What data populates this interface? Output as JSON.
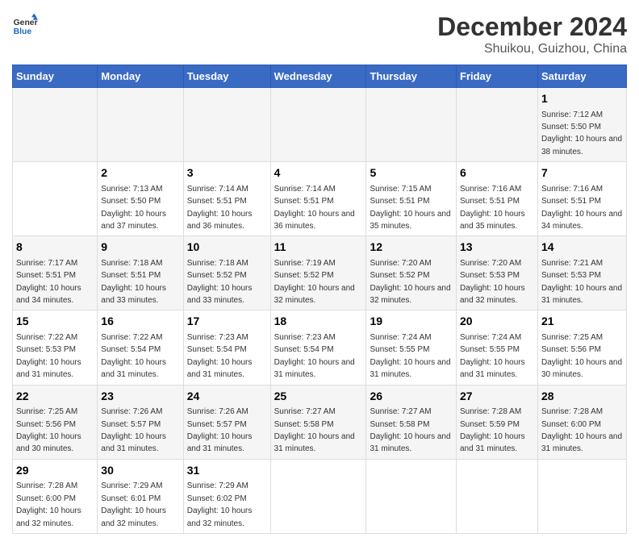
{
  "header": {
    "logo_line1": "General",
    "logo_line2": "Blue",
    "title": "December 2024",
    "subtitle": "Shuikou, Guizhou, China"
  },
  "calendar": {
    "days_of_week": [
      "Sunday",
      "Monday",
      "Tuesday",
      "Wednesday",
      "Thursday",
      "Friday",
      "Saturday"
    ],
    "weeks": [
      [
        null,
        null,
        null,
        null,
        null,
        null,
        {
          "day": "1",
          "sunrise": "Sunrise: 7:12 AM",
          "sunset": "Sunset: 5:50 PM",
          "daylight": "Daylight: 10 hours and 38 minutes."
        }
      ],
      [
        null,
        {
          "day": "2",
          "sunrise": "Sunrise: 7:13 AM",
          "sunset": "Sunset: 5:50 PM",
          "daylight": "Daylight: 10 hours and 37 minutes."
        },
        {
          "day": "3",
          "sunrise": "Sunrise: 7:14 AM",
          "sunset": "Sunset: 5:51 PM",
          "daylight": "Daylight: 10 hours and 36 minutes."
        },
        {
          "day": "4",
          "sunrise": "Sunrise: 7:14 AM",
          "sunset": "Sunset: 5:51 PM",
          "daylight": "Daylight: 10 hours and 36 minutes."
        },
        {
          "day": "5",
          "sunrise": "Sunrise: 7:15 AM",
          "sunset": "Sunset: 5:51 PM",
          "daylight": "Daylight: 10 hours and 35 minutes."
        },
        {
          "day": "6",
          "sunrise": "Sunrise: 7:16 AM",
          "sunset": "Sunset: 5:51 PM",
          "daylight": "Daylight: 10 hours and 35 minutes."
        },
        {
          "day": "7",
          "sunrise": "Sunrise: 7:16 AM",
          "sunset": "Sunset: 5:51 PM",
          "daylight": "Daylight: 10 hours and 34 minutes."
        }
      ],
      [
        {
          "day": "8",
          "sunrise": "Sunrise: 7:17 AM",
          "sunset": "Sunset: 5:51 PM",
          "daylight": "Daylight: 10 hours and 34 minutes."
        },
        {
          "day": "9",
          "sunrise": "Sunrise: 7:18 AM",
          "sunset": "Sunset: 5:51 PM",
          "daylight": "Daylight: 10 hours and 33 minutes."
        },
        {
          "day": "10",
          "sunrise": "Sunrise: 7:18 AM",
          "sunset": "Sunset: 5:52 PM",
          "daylight": "Daylight: 10 hours and 33 minutes."
        },
        {
          "day": "11",
          "sunrise": "Sunrise: 7:19 AM",
          "sunset": "Sunset: 5:52 PM",
          "daylight": "Daylight: 10 hours and 32 minutes."
        },
        {
          "day": "12",
          "sunrise": "Sunrise: 7:20 AM",
          "sunset": "Sunset: 5:52 PM",
          "daylight": "Daylight: 10 hours and 32 minutes."
        },
        {
          "day": "13",
          "sunrise": "Sunrise: 7:20 AM",
          "sunset": "Sunset: 5:53 PM",
          "daylight": "Daylight: 10 hours and 32 minutes."
        },
        {
          "day": "14",
          "sunrise": "Sunrise: 7:21 AM",
          "sunset": "Sunset: 5:53 PM",
          "daylight": "Daylight: 10 hours and 31 minutes."
        }
      ],
      [
        {
          "day": "15",
          "sunrise": "Sunrise: 7:22 AM",
          "sunset": "Sunset: 5:53 PM",
          "daylight": "Daylight: 10 hours and 31 minutes."
        },
        {
          "day": "16",
          "sunrise": "Sunrise: 7:22 AM",
          "sunset": "Sunset: 5:54 PM",
          "daylight": "Daylight: 10 hours and 31 minutes."
        },
        {
          "day": "17",
          "sunrise": "Sunrise: 7:23 AM",
          "sunset": "Sunset: 5:54 PM",
          "daylight": "Daylight: 10 hours and 31 minutes."
        },
        {
          "day": "18",
          "sunrise": "Sunrise: 7:23 AM",
          "sunset": "Sunset: 5:54 PM",
          "daylight": "Daylight: 10 hours and 31 minutes."
        },
        {
          "day": "19",
          "sunrise": "Sunrise: 7:24 AM",
          "sunset": "Sunset: 5:55 PM",
          "daylight": "Daylight: 10 hours and 31 minutes."
        },
        {
          "day": "20",
          "sunrise": "Sunrise: 7:24 AM",
          "sunset": "Sunset: 5:55 PM",
          "daylight": "Daylight: 10 hours and 31 minutes."
        },
        {
          "day": "21",
          "sunrise": "Sunrise: 7:25 AM",
          "sunset": "Sunset: 5:56 PM",
          "daylight": "Daylight: 10 hours and 30 minutes."
        }
      ],
      [
        {
          "day": "22",
          "sunrise": "Sunrise: 7:25 AM",
          "sunset": "Sunset: 5:56 PM",
          "daylight": "Daylight: 10 hours and 30 minutes."
        },
        {
          "day": "23",
          "sunrise": "Sunrise: 7:26 AM",
          "sunset": "Sunset: 5:57 PM",
          "daylight": "Daylight: 10 hours and 31 minutes."
        },
        {
          "day": "24",
          "sunrise": "Sunrise: 7:26 AM",
          "sunset": "Sunset: 5:57 PM",
          "daylight": "Daylight: 10 hours and 31 minutes."
        },
        {
          "day": "25",
          "sunrise": "Sunrise: 7:27 AM",
          "sunset": "Sunset: 5:58 PM",
          "daylight": "Daylight: 10 hours and 31 minutes."
        },
        {
          "day": "26",
          "sunrise": "Sunrise: 7:27 AM",
          "sunset": "Sunset: 5:58 PM",
          "daylight": "Daylight: 10 hours and 31 minutes."
        },
        {
          "day": "27",
          "sunrise": "Sunrise: 7:28 AM",
          "sunset": "Sunset: 5:59 PM",
          "daylight": "Daylight: 10 hours and 31 minutes."
        },
        {
          "day": "28",
          "sunrise": "Sunrise: 7:28 AM",
          "sunset": "Sunset: 6:00 PM",
          "daylight": "Daylight: 10 hours and 31 minutes."
        }
      ],
      [
        {
          "day": "29",
          "sunrise": "Sunrise: 7:28 AM",
          "sunset": "Sunset: 6:00 PM",
          "daylight": "Daylight: 10 hours and 32 minutes."
        },
        {
          "day": "30",
          "sunrise": "Sunrise: 7:29 AM",
          "sunset": "Sunset: 6:01 PM",
          "daylight": "Daylight: 10 hours and 32 minutes."
        },
        {
          "day": "31",
          "sunrise": "Sunrise: 7:29 AM",
          "sunset": "Sunset: 6:02 PM",
          "daylight": "Daylight: 10 hours and 32 minutes."
        },
        null,
        null,
        null,
        null
      ]
    ]
  }
}
